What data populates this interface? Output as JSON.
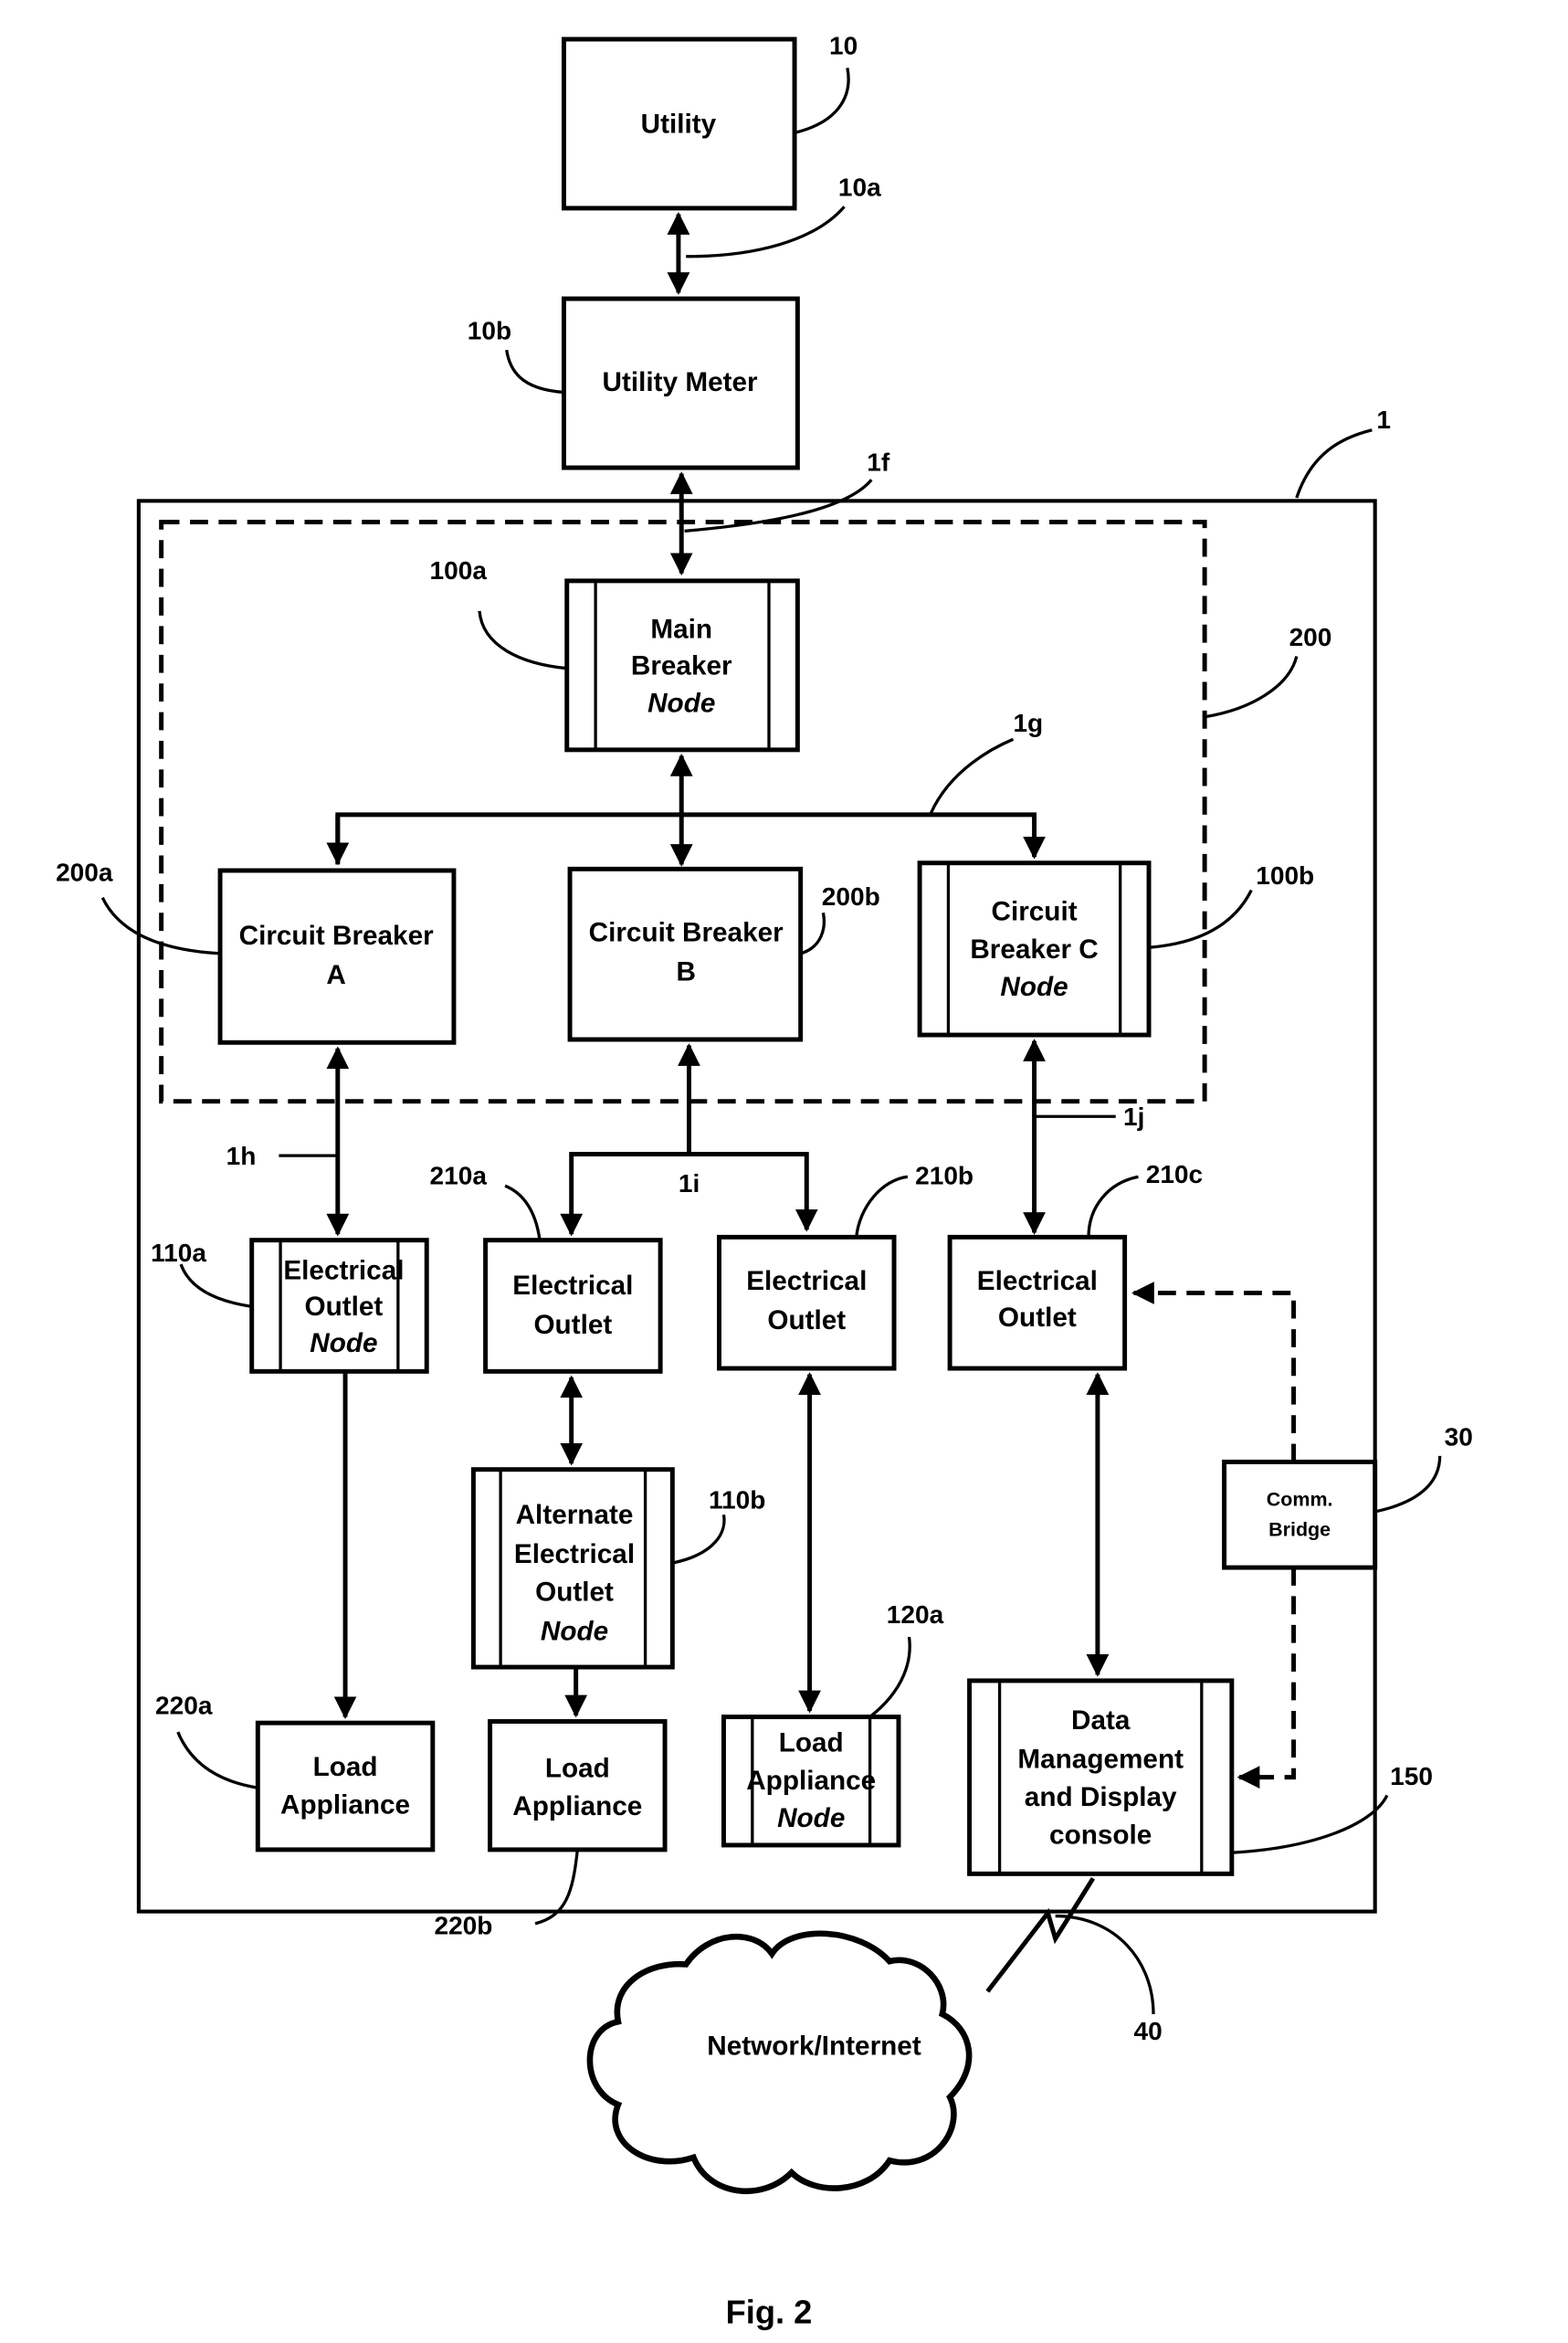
{
  "figure": {
    "caption": "Fig. 2",
    "blocks": {
      "utility": {
        "lines": [
          "Utility"
        ],
        "ref": "10"
      },
      "utility_meter": {
        "lines": [
          "Utility Meter"
        ],
        "ref": "10b"
      },
      "main_breaker": {
        "lines": [
          "Main",
          "Breaker",
          "Node"
        ],
        "ref": "100a"
      },
      "breaker_a": {
        "lines": [
          "Circuit Breaker",
          "A"
        ],
        "ref": "200a"
      },
      "breaker_b": {
        "lines": [
          "Circuit Breaker",
          "B"
        ],
        "ref": "200b"
      },
      "breaker_c": {
        "lines": [
          "Circuit",
          "Breaker C",
          "Node"
        ],
        "ref": "100b"
      },
      "outlet_node_a": {
        "lines": [
          "Electrical",
          "Outlet",
          "Node"
        ],
        "ref": "110a"
      },
      "outlet_210a": {
        "lines": [
          "Electrical",
          "Outlet"
        ],
        "ref": "210a"
      },
      "outlet_210b": {
        "lines": [
          "Electrical",
          "Outlet"
        ],
        "ref": "210b"
      },
      "outlet_210c": {
        "lines": [
          "Electrical",
          "Outlet"
        ],
        "ref": "210c"
      },
      "alt_outlet_node": {
        "lines": [
          "Alternate",
          "Electrical",
          "Outlet",
          "Node"
        ],
        "ref": "110b"
      },
      "load_220a": {
        "lines": [
          "Load",
          "Appliance"
        ],
        "ref": "220a"
      },
      "load_220b": {
        "lines": [
          "Load",
          "Appliance"
        ],
        "ref": "220b"
      },
      "load_node_120a": {
        "lines": [
          "Load",
          "Appliance",
          "Node"
        ],
        "ref": "120a"
      },
      "comm_bridge": {
        "lines": [
          "Comm.",
          "Bridge"
        ],
        "ref": "30"
      },
      "console": {
        "lines": [
          "Data",
          "Management",
          "and Display",
          "console"
        ],
        "ref": "150"
      },
      "network": {
        "lines": [
          "Network/Internet"
        ],
        "ref": "40"
      }
    },
    "refs": {
      "link_10a": "10a",
      "system": "1",
      "link_1f": "1f",
      "panel": "200",
      "link_1g": "1g",
      "link_1h": "1h",
      "link_1i": "1i",
      "link_1j": "1j"
    }
  }
}
